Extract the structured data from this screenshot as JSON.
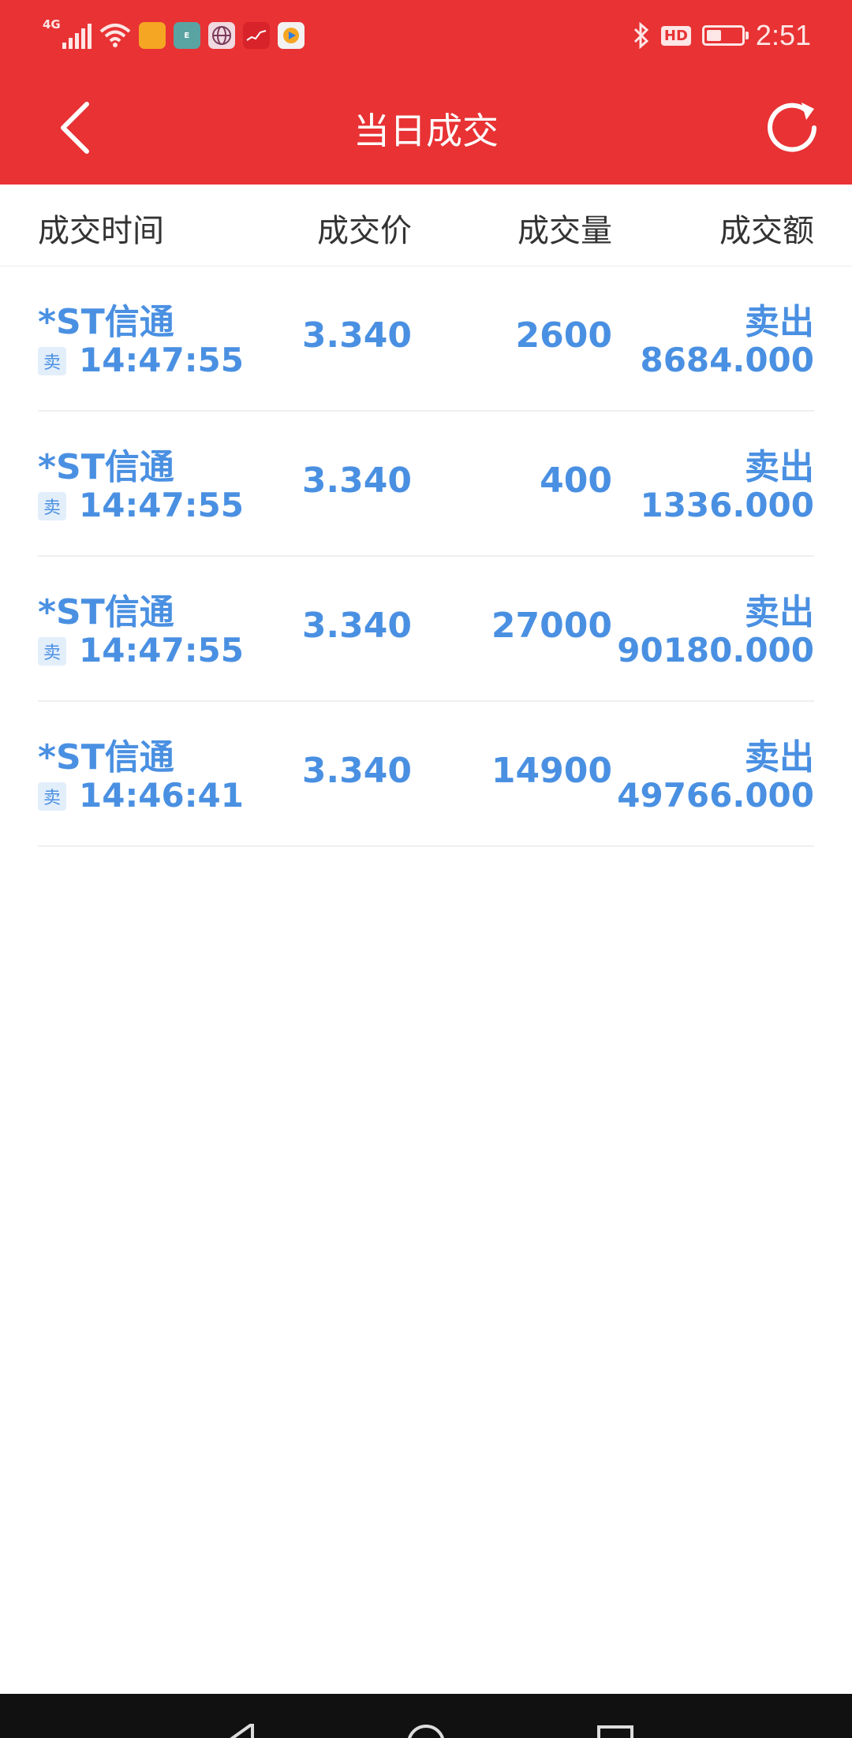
{
  "status_bar": {
    "network": "4G",
    "time": "2:51",
    "hd_label": "HD",
    "battery_level": 0.35,
    "app_icons": [
      "news-icon",
      "emui-icon",
      "globe-icon",
      "stock-chart-icon",
      "video-icon"
    ]
  },
  "nav": {
    "title": "当日成交",
    "back_icon": "chevron-left-icon",
    "refresh_icon": "refresh-icon"
  },
  "table": {
    "headers": [
      "成交时间",
      "成交价",
      "成交量",
      "成交额"
    ],
    "rows": [
      {
        "name": "*ST信通",
        "badge": "卖",
        "time": "14:47:55",
        "price": "3.340",
        "volume": "2600",
        "direction": "卖出",
        "amount": "8684.000"
      },
      {
        "name": "*ST信通",
        "badge": "卖",
        "time": "14:47:55",
        "price": "3.340",
        "volume": "400",
        "direction": "卖出",
        "amount": "1336.000"
      },
      {
        "name": "*ST信通",
        "badge": "卖",
        "time": "14:47:55",
        "price": "3.340",
        "volume": "27000",
        "direction": "卖出",
        "amount": "90180.000"
      },
      {
        "name": "*ST信通",
        "badge": "卖",
        "time": "14:46:41",
        "price": "3.340",
        "volume": "14900",
        "direction": "卖出",
        "amount": "49766.000"
      }
    ]
  },
  "colors": {
    "brand_red": "#e83234",
    "data_blue": "#4a90e2"
  }
}
